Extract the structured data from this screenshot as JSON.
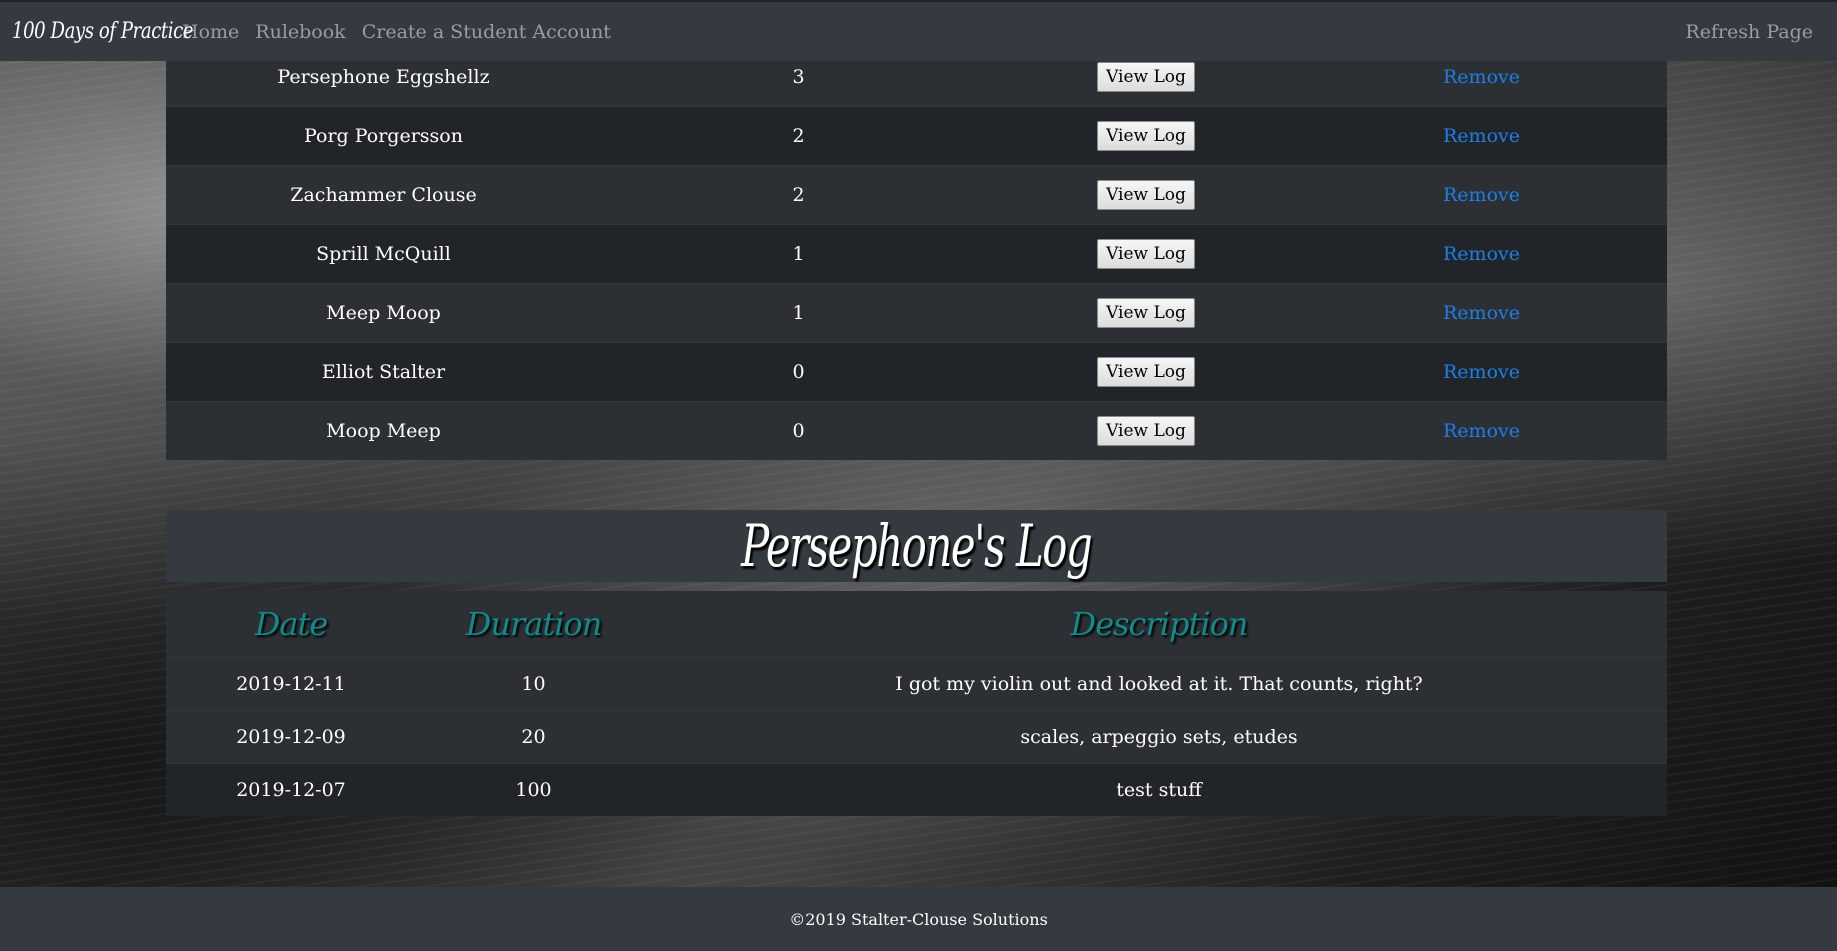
{
  "navbar": {
    "brand": "100 Days of Practice",
    "links": [
      {
        "label": "Home"
      },
      {
        "label": "Rulebook"
      },
      {
        "label": "Create a Student Account"
      }
    ],
    "refresh_label": "Refresh Page"
  },
  "students": {
    "view_label": "View Log",
    "remove_label": "Remove",
    "rows": [
      {
        "name": "Persephone Eggshellz",
        "count": "3"
      },
      {
        "name": "Porg Porgersson",
        "count": "2"
      },
      {
        "name": "Zachammer Clouse",
        "count": "2"
      },
      {
        "name": "Sprill McQuill",
        "count": "1"
      },
      {
        "name": "Meep Moop",
        "count": "1"
      },
      {
        "name": "Elliot Stalter",
        "count": "0"
      },
      {
        "name": "Moop Meep",
        "count": "0"
      }
    ]
  },
  "log": {
    "title": "Persephone's Log",
    "headers": {
      "date": "Date",
      "duration": "Duration",
      "description": "Description"
    },
    "rows": [
      {
        "date": "2019-12-11",
        "duration": "10",
        "description": "I got my violin out and looked at it. That counts, right?"
      },
      {
        "date": "2019-12-09",
        "duration": "20",
        "description": "scales, arpeggio sets, etudes"
      },
      {
        "date": "2019-12-07",
        "duration": "100",
        "description": "test stuff"
      }
    ]
  },
  "footer": {
    "text": "©2019 Stalter-Clouse Solutions"
  },
  "colors": {
    "navbar": "#343a40",
    "link": "#1e7ee6",
    "header_teal": "#128a8a"
  }
}
